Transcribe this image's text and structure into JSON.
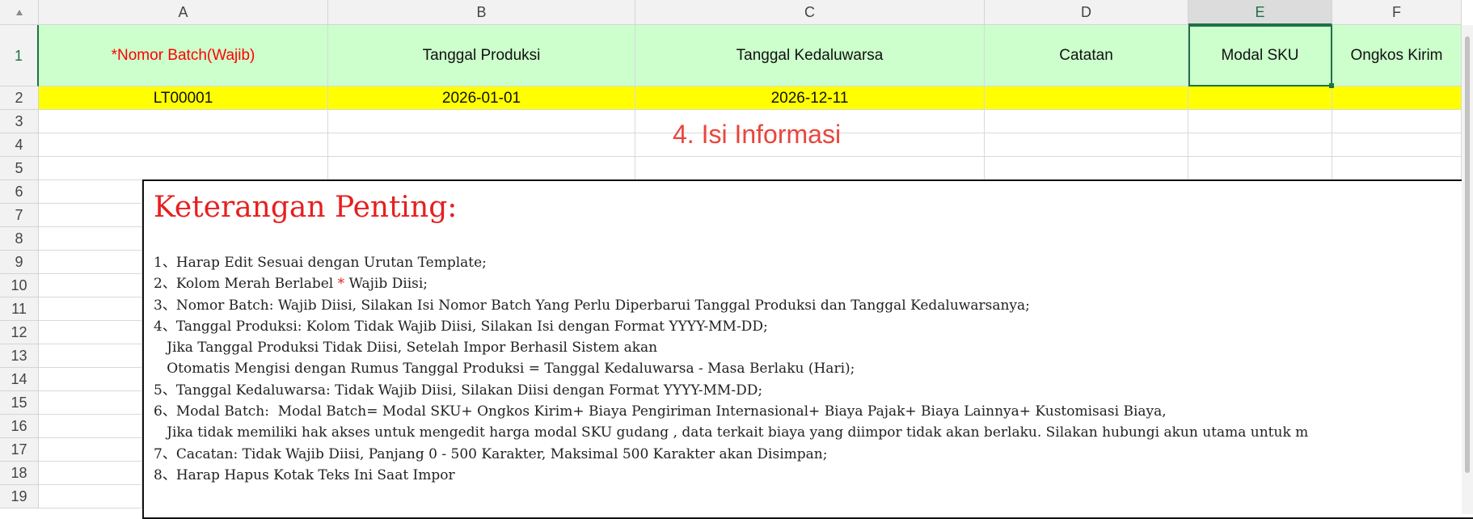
{
  "columns": [
    "A",
    "B",
    "C",
    "D",
    "E",
    "F"
  ],
  "row_numbers": [
    "1",
    "2",
    "3",
    "4",
    "5",
    "6",
    "7",
    "8",
    "9",
    "10",
    "11",
    "12",
    "13",
    "14",
    "15",
    "16",
    "17",
    "18",
    "19"
  ],
  "headers": {
    "a": "*Nomor Batch(Wajib)",
    "b": "Tanggal Produksi",
    "c": "Tanggal Kedaluwarsa",
    "d": "Catatan",
    "e": "Modal SKU",
    "f": "Ongkos Kirim"
  },
  "row2": {
    "a": "LT00001",
    "b": "2026-01-01",
    "c": "2026-12-11",
    "d": "",
    "e": "",
    "f": ""
  },
  "overlay_label": "4. Isi Informasi",
  "textbox": {
    "title": "Keterangan Penting:",
    "lines": [
      "1、Harap Edit Sesuai dengan Urutan Template;",
      "2、Kolom Merah Berlabel ",
      "3、Nomor Batch: Wajib Diisi, Silakan Isi Nomor Batch Yang Perlu Diperbarui Tanggal Produksi dan Tanggal Kedaluwarsanya;",
      "4、Tanggal Produksi: Kolom Tidak Wajib Diisi, Silakan Isi dengan Format YYYY-MM-DD;",
      "   Jika Tanggal Produksi Tidak Diisi, Setelah Impor Berhasil Sistem akan",
      "   Otomatis Mengisi dengan Rumus Tanggal Produksi = Tanggal Kedaluwarsa - Masa Berlaku (Hari);",
      "5、Tanggal Kedaluwarsa: Tidak Wajib Diisi, Silakan Diisi dengan Format YYYY-MM-DD;",
      "6、Modal Batch:  Modal Batch= Modal SKU+ Ongkos Kirim+ Biaya Pengiriman Internasional+ Biaya Pajak+ Biaya Lainnya+ Kustomisasi Biaya,",
      "   Jika tidak memiliki hak akses untuk mengedit harga modal SKU gudang , data terkait biaya yang diimpor tidak akan berlaku. Silakan hubungi akun utama untuk m",
      "7、Cacatan: Tidak Wajib Diisi, Panjang 0 - 500 Karakter, Maksimal 500 Karakter akan Disimpan;",
      "8、Harap Hapus Kotak Teks Ini Saat Impor"
    ],
    "line2_star": "*",
    "line2_rest": " Wajib Diisi;"
  },
  "colors": {
    "header_fill": "#ccffcc",
    "row2_fill": "#ffff00",
    "required_red": "#ff0000",
    "selection_green": "#1e7145",
    "overlay_red": "#e8453c"
  }
}
